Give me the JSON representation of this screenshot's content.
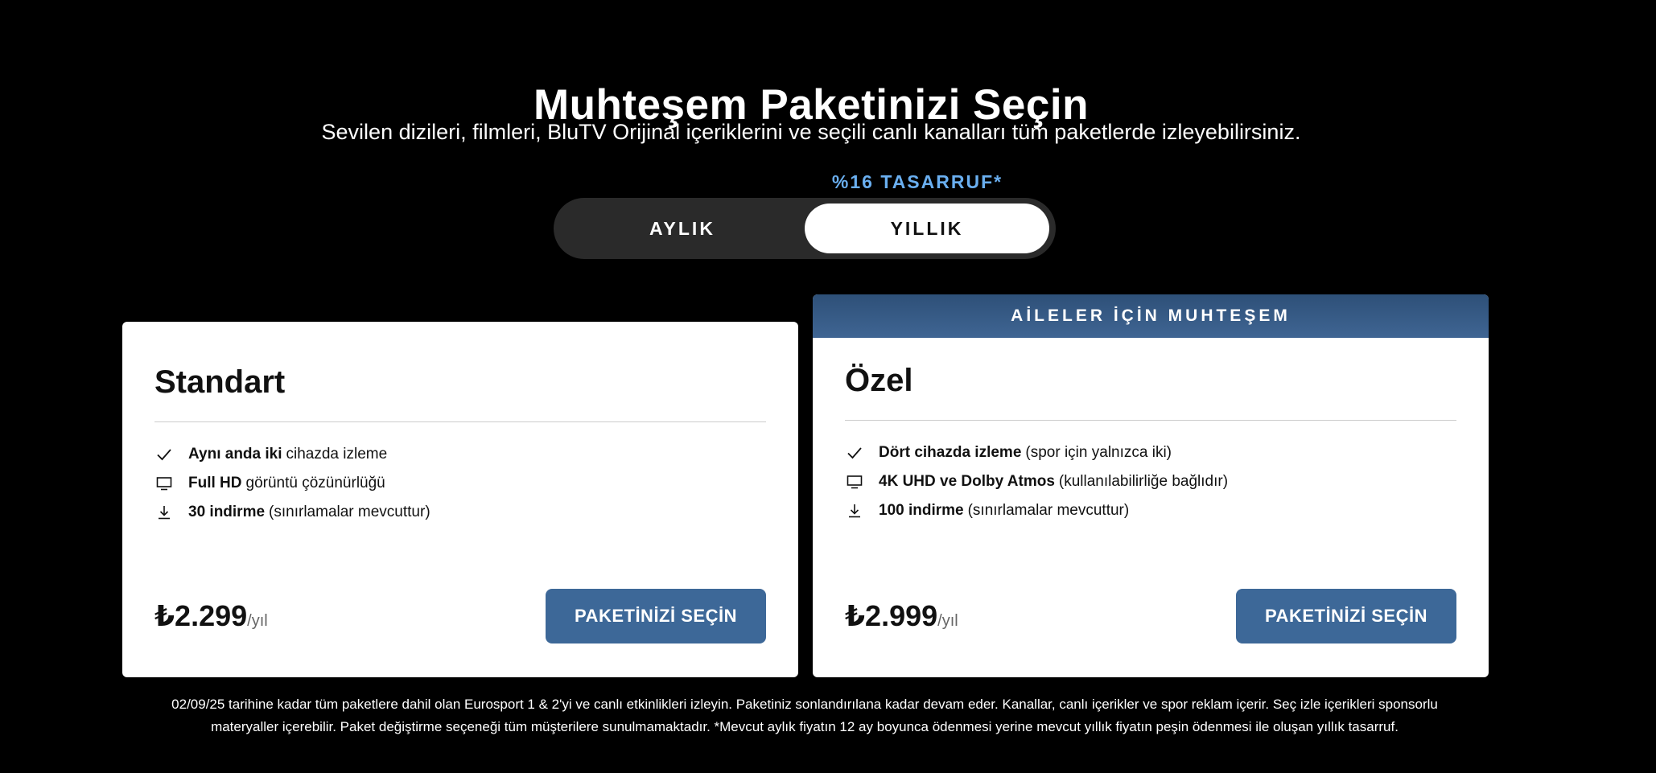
{
  "header": {
    "title": "Muhteşem Paketinizi Seçin",
    "subtitle": "Sevilen dizileri, filmleri, BluTV Orijinal içeriklerini ve seçili canlı kanalları tüm paketlerde izleyebilirsiniz."
  },
  "billing_toggle": {
    "savings_label": "%16 TASARRUF*",
    "monthly_label": "AYLIK",
    "yearly_label": "YILLIK",
    "selected": "YILLIK"
  },
  "plans": [
    {
      "name": "Standart",
      "features": [
        {
          "icon": "check-icon",
          "bold": "Aynı anda iki",
          "text": "cihazda izleme"
        },
        {
          "icon": "monitor-icon",
          "bold": "Full HD",
          "text": "görüntü çözünürlüğü"
        },
        {
          "icon": "download-icon",
          "bold": "30 indirme",
          "text": "(sınırlamalar mevcuttur)"
        }
      ],
      "price": "₺2.299",
      "period": "/yıl",
      "cta": "PAKETİNİZİ SEÇİN"
    },
    {
      "banner": "AİLELER İÇİN MUHTEŞEM",
      "name": "Özel",
      "features": [
        {
          "icon": "check-icon",
          "bold": "Dört cihazda izleme",
          "text": "(spor için yalnızca iki)"
        },
        {
          "icon": "monitor-icon",
          "bold": "4K UHD ve Dolby Atmos",
          "text": "(kullanılabilirliğe bağlıdır)"
        },
        {
          "icon": "download-icon",
          "bold": "100 indirme",
          "text": "(sınırlamalar mevcuttur)"
        }
      ],
      "price": "₺2.999",
      "period": "/yıl",
      "cta": "PAKETİNİZİ SEÇİN"
    }
  ],
  "footnote": {
    "line1": "02/09/25 tarihine kadar tüm paketlere dahil olan Eurosport 1 & 2'yi ve canlı etkinlikleri izleyin. Paketiniz sonlandırılana kadar devam eder. Kanallar, canlı içerikler ve spor reklam içerir. Seç izle içerikleri sponsorlu",
    "line2": "materyaller içerebilir. Paket değiştirme seçeneği tüm müşterilere sunulmamaktadır. *Mevcut aylık fiyatın 12 ay boyunca ödenmesi yerine mevcut yıllık fiyatın peşin ödenmesi ile oluşan yıllık tasarruf."
  },
  "colors": {
    "background": "#000000",
    "accent_blue": "#3d6898",
    "savings_blue": "#6aaff0",
    "banner_blue": "#2e5078"
  }
}
